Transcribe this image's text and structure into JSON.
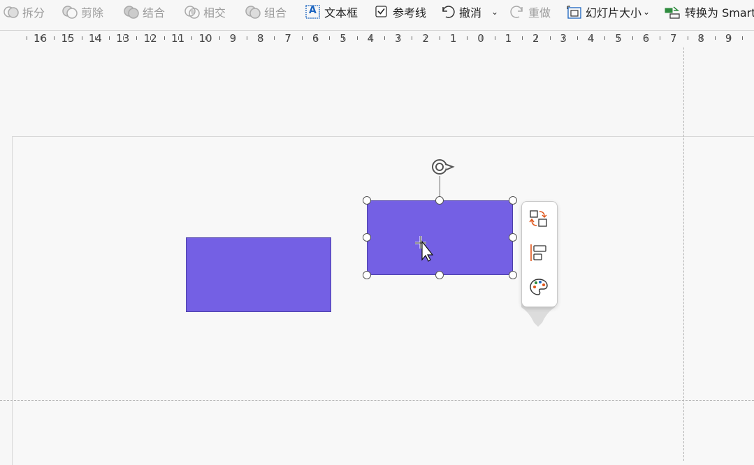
{
  "toolbar": {
    "items": [
      {
        "label": "拆分",
        "icon": "split-icon",
        "disabled": true
      },
      {
        "label": "剪除",
        "icon": "subtract-icon",
        "disabled": true
      },
      {
        "label": "结合",
        "icon": "combine-icon",
        "disabled": true
      },
      {
        "label": "相交",
        "icon": "intersect-icon",
        "disabled": true
      },
      {
        "label": "组合",
        "icon": "group-icon",
        "disabled": true
      },
      {
        "label": "文本框",
        "icon": "textbox-icon",
        "disabled": false
      },
      {
        "label": "参考线",
        "icon": "checkbox-icon",
        "disabled": false
      },
      {
        "label": "撤消",
        "icon": "undo-icon",
        "disabled": false
      },
      {
        "label": "重做",
        "icon": "redo-icon",
        "disabled": true
      },
      {
        "label": "幻灯片大小",
        "icon": "slide-size-icon",
        "disabled": false
      },
      {
        "label": "转换为 Smart",
        "icon": "convert-smart-icon",
        "disabled": false
      }
    ],
    "textbox_glyph": "A"
  },
  "ruler": {
    "labels": [
      "16",
      "15",
      "14",
      "13",
      "12",
      "11",
      "10",
      "9",
      "8",
      "7",
      "6",
      "5",
      "4",
      "3",
      "2",
      "1",
      "0",
      "1",
      "2",
      "3",
      "4",
      "5",
      "6",
      "7",
      "8",
      "9"
    ]
  },
  "colors": {
    "shape_fill": "#7460e4",
    "shape_border": "#4b3ea8"
  },
  "floating_panel": {
    "buttons": [
      "change-shape-icon",
      "align-icon",
      "palette-icon"
    ]
  }
}
